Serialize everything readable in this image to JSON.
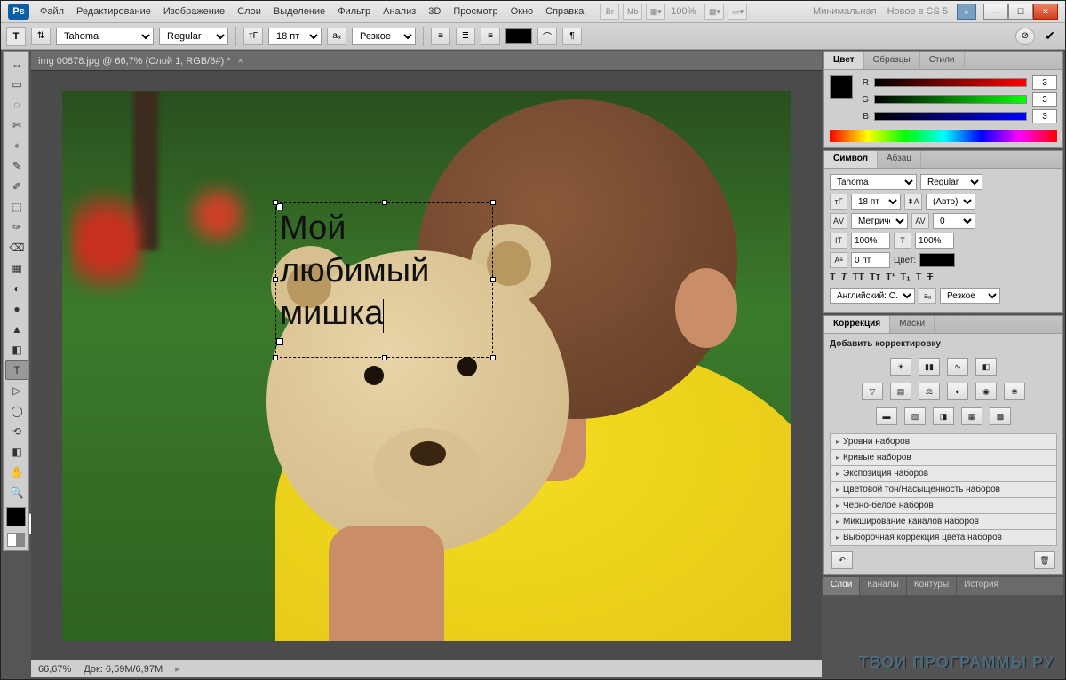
{
  "app_logo": "Ps",
  "menu": [
    "Файл",
    "Редактирование",
    "Изображение",
    "Слои",
    "Выделение",
    "Фильтр",
    "Анализ",
    "3D",
    "Просмотр",
    "Окно",
    "Справка"
  ],
  "menubar_zoom": "100%",
  "menubar_right": {
    "minimal": "Минимальная",
    "news": "Новое в CS 5"
  },
  "options": {
    "font_family": "Tahoma",
    "font_style": "Regular",
    "font_size": "18 пт",
    "aa": "Резкое"
  },
  "doc_tab": "img 00878.jpg @ 66,7% (Слой 1, RGB/8#) *",
  "canvas_text_lines": [
    "Мой",
    "любимый",
    "мишка"
  ],
  "status": {
    "zoom": "66,67%",
    "doc": "Док: 6,59M/6,97M"
  },
  "color_panel": {
    "tabs": [
      "Цвет",
      "Образцы",
      "Стили"
    ],
    "r_label": "R",
    "g_label": "G",
    "b_label": "B",
    "r": "3",
    "g": "3",
    "b": "3"
  },
  "char_panel": {
    "tabs": [
      "Символ",
      "Абзац"
    ],
    "font_family": "Tahoma",
    "font_style": "Regular",
    "size": "18 пт",
    "leading": "(Авто)",
    "kerning": "Метричес",
    "tracking": "0",
    "vscale": "100%",
    "hscale": "100%",
    "baseline": "0 пт",
    "color_label": "Цвет:",
    "lang": "Английский: С...",
    "aa": "Резкое"
  },
  "adjust_panel": {
    "tabs": [
      "Коррекция",
      "Маски"
    ],
    "title": "Добавить корректировку",
    "list": [
      "Уровни наборов",
      "Кривые наборов",
      "Экспозиция наборов",
      "Цветовой тон/Насыщенность наборов",
      "Черно-белое наборов",
      "Микширование каналов наборов",
      "Выборочная коррекция цвета наборов"
    ]
  },
  "layers_panel": {
    "tabs": [
      "Слои",
      "Каналы",
      "Контуры",
      "История"
    ]
  },
  "watermark": "ТВОИ ПРОГРАММЫ РУ",
  "tool_glyphs": [
    "↔",
    "▭",
    "◌",
    "✄",
    "⌖",
    "✎",
    "✐",
    "⬚",
    "✑",
    "⌫",
    "▦",
    "◐",
    "●",
    "▲",
    "◧",
    "⟲",
    "T",
    "▷",
    "◯",
    "✋",
    "🔍"
  ]
}
